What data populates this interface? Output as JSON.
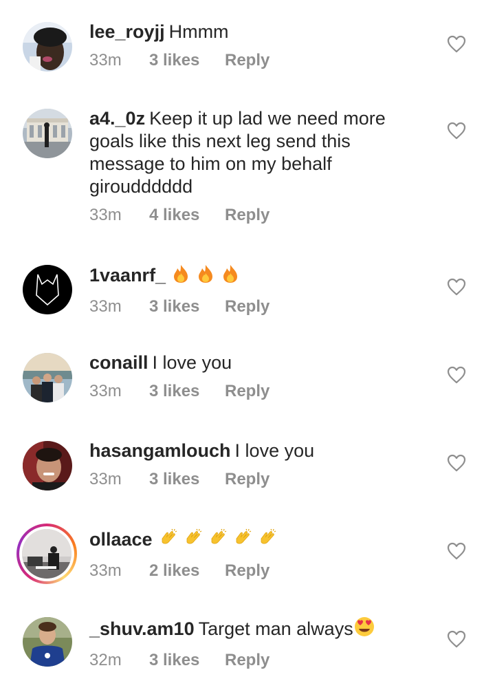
{
  "comments": [
    {
      "username": "lee_royjj",
      "text": "Hmmm",
      "time": "33m",
      "likes": "3 likes",
      "reply": "Reply",
      "avatar_icon": "user-avatar-photo"
    },
    {
      "username": "a4._0z",
      "text": "Keep it up lad we need more goals like this next leg send this message to him on my behalf giroudddddd",
      "time": "33m",
      "likes": "4 likes",
      "reply": "Reply",
      "avatar_icon": "user-avatar-building"
    },
    {
      "username": "1vaanrf_",
      "text": "",
      "emoji": [
        "fire-icon",
        "fire-icon",
        "fire-icon"
      ],
      "time": "33m",
      "likes": "3 likes",
      "reply": "Reply",
      "avatar_icon": "user-avatar-batman"
    },
    {
      "username": "conaill",
      "text": "I love you",
      "time": "33m",
      "likes": "3 likes",
      "reply": "Reply",
      "avatar_icon": "user-avatar-group"
    },
    {
      "username": "hasangamlouch",
      "text": "I love you",
      "time": "33m",
      "likes": "3 likes",
      "reply": "Reply",
      "avatar_icon": "user-avatar-selfie"
    },
    {
      "username": "ollaace",
      "text": "",
      "emoji": [
        "clapping-hands-icon",
        "clapping-hands-icon",
        "clapping-hands-icon",
        "clapping-hands-icon",
        "clapping-hands-icon"
      ],
      "time": "33m",
      "likes": "2 likes",
      "reply": "Reply",
      "avatar_icon": "user-avatar-room",
      "story_ring": true
    },
    {
      "username": "_shuv.am10",
      "text": "Target man always",
      "emoji": [
        "heart-eyes-icon"
      ],
      "time": "32m",
      "likes": "3 likes",
      "reply": "Reply",
      "avatar_icon": "user-avatar-player"
    }
  ],
  "colors": {
    "text": "#262626",
    "meta": "#8e8e8e",
    "heart_outline": "#8e8e8e"
  }
}
